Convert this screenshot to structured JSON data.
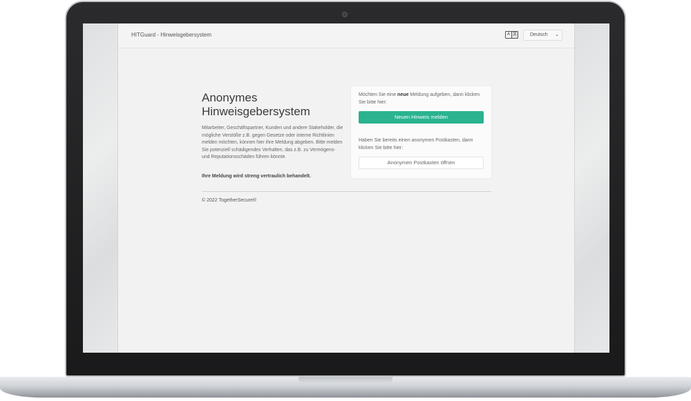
{
  "header": {
    "app_title": "HITGuard - Hinweisgebersystem",
    "translate_icon": "translate-icon",
    "translate_glyph_left": "A",
    "translate_glyph_right": "文",
    "language": "Deutsch",
    "chevron_icon": "chevron-down-icon"
  },
  "main": {
    "title_line1": "Anonymes",
    "title_line2": "Hinweisgebersystem",
    "intro": "Mitarbeiter, Geschäftspartner, Kunden und andere Stakeholder, die mögliche Verstöße z.B. gegen Gesetze oder interne Richtlinien melden möchten, können hier ihre Meldung abgeben. Bitte melden Sie potenziell schädigendes Verhalten, das z.B. zu Vermögens- und Reputationsschäden führen könnte.",
    "confidential": "Ihre Meldung wird streng vertraulich behandelt."
  },
  "card": {
    "new_prompt_before": "Möchten Sie eine ",
    "new_prompt_bold": "neue",
    "new_prompt_after": " Meldung aufgeben, dann klicken Sie bitte hier:",
    "new_button": "Neuen Hinweis melden",
    "existing_prompt": "Haben Sie bereits einen anonymen Postkasten, dann klicken Sie bitte hier:",
    "existing_button": "Anonymen Postkasten öffnen"
  },
  "footer": {
    "copyright": "© 2022 TogetherSecure®"
  },
  "colors": {
    "accent": "#2bb38f",
    "frame": "#1c1c1d",
    "page_bg": "#f2f2f2"
  }
}
